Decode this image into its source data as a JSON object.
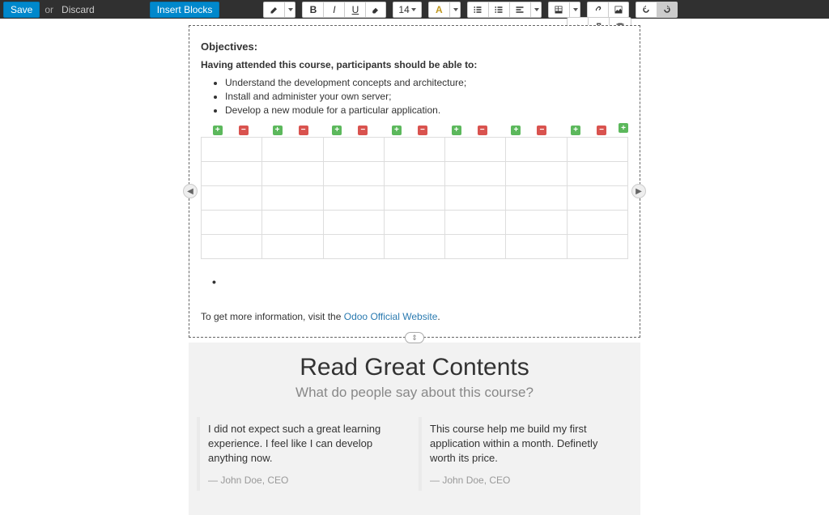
{
  "toolbar": {
    "save": "Save",
    "or": "or",
    "discard": "Discard",
    "insert_blocks": "Insert Blocks",
    "font_size": "14"
  },
  "content": {
    "objectives_label": "Objectives:",
    "objectives_intro": "Having attended this course, participants should be able to:",
    "objectives": [
      "Understand the development concepts and architecture;",
      "Install and administer your own server;",
      "Develop a new module for a particular application."
    ],
    "info_prefix": "To get more information, visit the ",
    "info_link_text": "Odoo Official Website",
    "info_suffix": "."
  },
  "read": {
    "title": "Read Great Contents",
    "subtitle": "What do people say about this course?",
    "quotes": [
      {
        "text": "I did not expect such a great learning experience. I feel like I can develop anything now.",
        "author": "— John Doe, CEO"
      },
      {
        "text": "This course help me build my first application within a month. Definetly worth its price.",
        "author": "— John Doe, CEO"
      }
    ]
  },
  "table": {
    "cols": 7,
    "rows": 5
  }
}
